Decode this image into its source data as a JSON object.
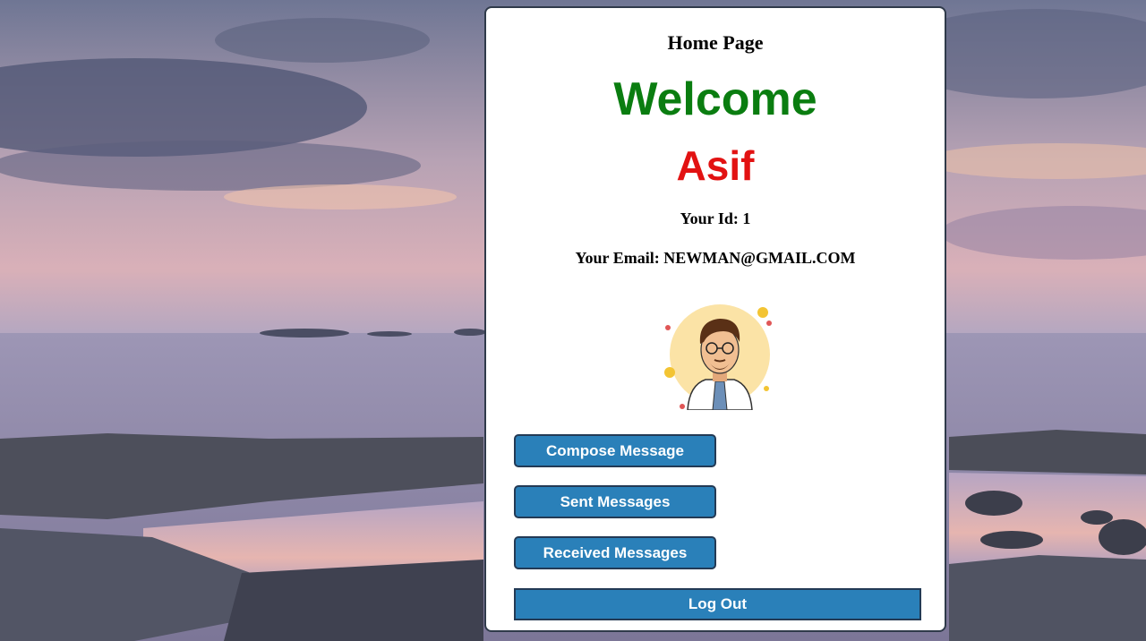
{
  "page": {
    "title": "Home Page",
    "welcome": "Welcome",
    "username": "Asif",
    "id_text": "Your Id: 1",
    "email_text": "Your Email: NEWMAN@GMAIL.COM"
  },
  "avatar": {
    "icon": "user-avatar-icon"
  },
  "buttons": {
    "compose": "Compose Message",
    "sent": "Sent Messages",
    "received": "Received Messages",
    "logout": "Log Out"
  },
  "colors": {
    "welcome": "#0a7d10",
    "username": "#e21212",
    "button": "#2a80b9",
    "button_border": "#233a55"
  }
}
